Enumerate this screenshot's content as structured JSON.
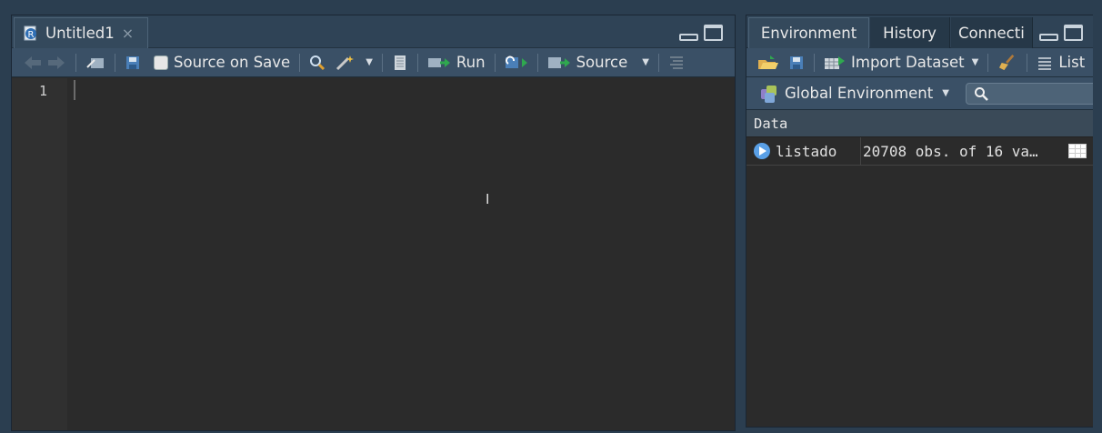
{
  "source_pane": {
    "tab_title": "Untitled1",
    "tab_close": "×",
    "toolbar": {
      "source_on_save": "Source on Save",
      "run": "Run",
      "source": "Source"
    },
    "editor": {
      "line_numbers": [
        "1"
      ]
    }
  },
  "env_pane": {
    "tabs": [
      "Environment",
      "History",
      "Connecti"
    ],
    "toolbar": {
      "import_dataset": "Import Dataset",
      "list": "List"
    },
    "scope": "Global Environment",
    "search_placeholder": "",
    "section_header": "Data",
    "rows": [
      {
        "name": "listado",
        "value": "20708 obs. of 16 va…"
      }
    ]
  },
  "colors": {
    "background": "#2b3e50",
    "editor_bg": "#2b2b2b",
    "toolbar_bg": "#3a5066",
    "accent": "#5aa0e6"
  }
}
